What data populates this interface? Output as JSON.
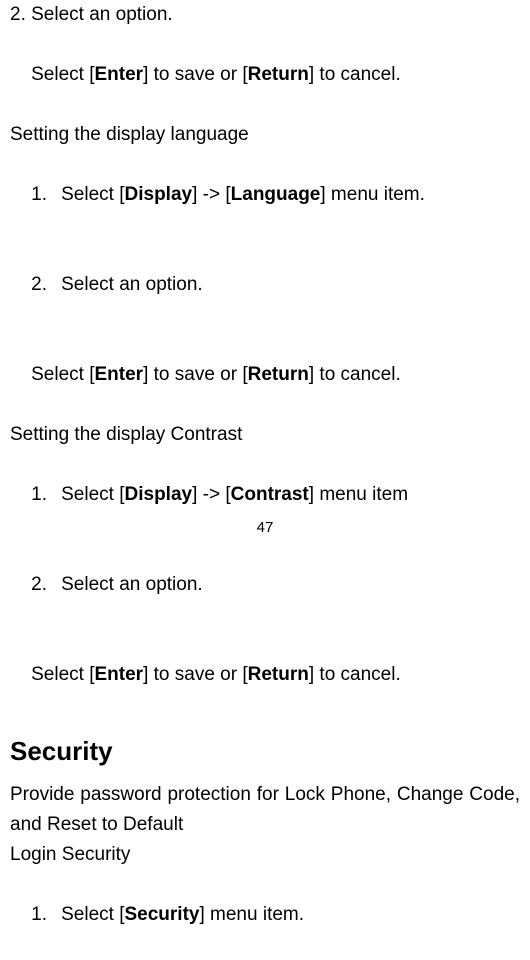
{
  "block1": {
    "step2": "2. Select an option.",
    "save_prefix": "Select [",
    "enter": "Enter",
    "save_mid": "] to save or [",
    "return": "Return",
    "save_suffix": "] to cancel."
  },
  "language_section": {
    "title": "Setting the display language",
    "step1_num": "1.",
    "step1_a": "Select [",
    "step1_display": "Display",
    "step1_b": "] -> [",
    "step1_language": "Language",
    "step1_c": "] menu item.",
    "step2_num": "2.",
    "step2_text": "Select an option.",
    "save_prefix": "Select [",
    "enter": "Enter",
    "save_mid": "] to save or [",
    "return": "Return",
    "save_suffix": "] to cancel."
  },
  "contrast_section": {
    "title": "Setting the display Contrast",
    "step1_num": "1.",
    "step1_a": "Select [",
    "step1_display": "Display",
    "step1_b": "] -> [",
    "step1_contrast": "Contrast",
    "step1_c": "] menu item",
    "step2_num": "2.",
    "step2_text": "Select an option.",
    "save_prefix": "Select [",
    "enter": "Enter",
    "save_mid": "] to save or [",
    "return": "Return",
    "save_suffix": "] to cancel."
  },
  "security_section": {
    "heading": "Security",
    "desc": "Provide password protection for Lock Phone, Change Code, and Reset to Default",
    "login": "Login Security",
    "step1_num": "1.",
    "step1_a": "Select [",
    "step1_security": "Security",
    "step1_c": "] menu item."
  },
  "page_number": "47"
}
